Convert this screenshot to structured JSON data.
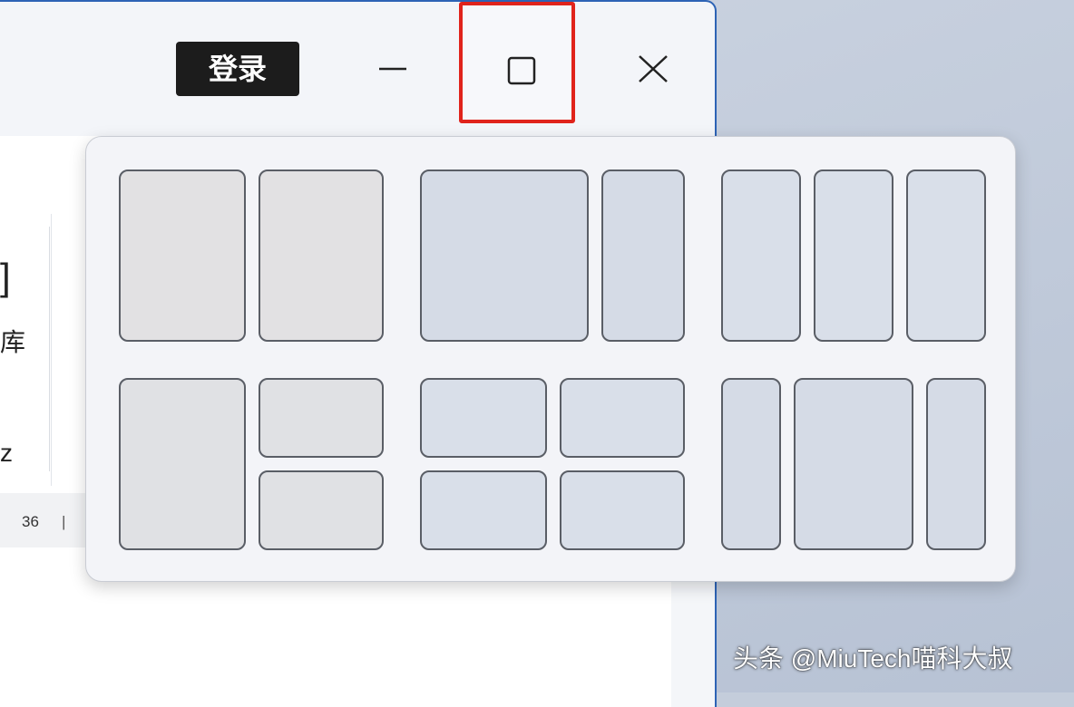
{
  "titlebar": {
    "login_label": "登录",
    "icons": [
      "minimize-icon",
      "maximize-icon",
      "close-icon"
    ]
  },
  "sidebar": {
    "glyph_top": "]",
    "glyph_mid": "库",
    "glyph_low": "z"
  },
  "statusbar": {
    "count": "36",
    "separator": "|"
  },
  "snap_layouts": {
    "layouts": [
      {
        "name": "two-equal",
        "zones": 2
      },
      {
        "name": "wide-left-narrow-right",
        "zones": 2
      },
      {
        "name": "three-columns",
        "zones": 3
      },
      {
        "name": "left-plus-two-stacked",
        "zones": 3
      },
      {
        "name": "four-quadrants",
        "zones": 4
      },
      {
        "name": "narrow-wide-narrow",
        "zones": 3
      }
    ]
  },
  "colors": {
    "highlight_border": "#e0231b",
    "window_border": "#2d63b5",
    "login_bg": "#1c1c1c"
  },
  "watermark": "头条 @MiuTech喵科大叔"
}
